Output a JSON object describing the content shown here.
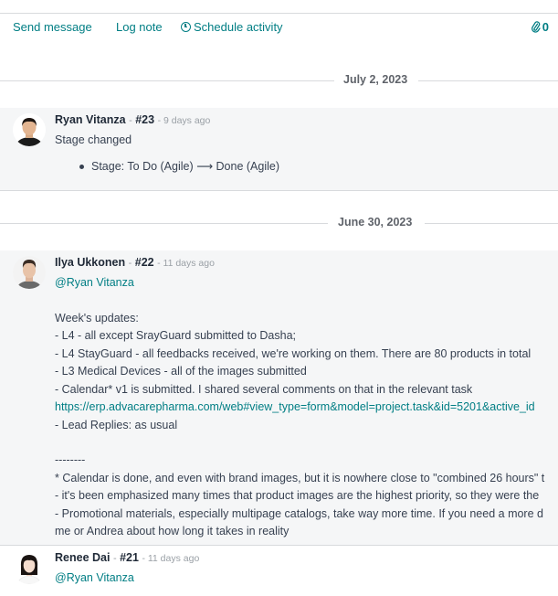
{
  "toolbar": {
    "send_message": "Send message",
    "log_note": "Log note",
    "schedule_activity": "Schedule activity",
    "attachments_count": "0"
  },
  "separators": [
    {
      "date": "July 2, 2023"
    },
    {
      "date": "June 30, 2023"
    }
  ],
  "messages": [
    {
      "author": "Ryan Vitanza",
      "dash": "-",
      "ref": "#23",
      "ago": "- 9 days ago",
      "body": "Stage changed",
      "tracking": {
        "field": "Stage:",
        "old": "To Do (Agile)",
        "arrow": "⟶",
        "new": "Done (Agile)"
      }
    },
    {
      "author": "Ilya Ukkonen",
      "dash": "-",
      "ref": "#22",
      "ago": "- 11 days ago",
      "mention": "@Ryan Vitanza",
      "lines": [
        "Week's updates:",
        "- L4 - all except SrayGuard submitted to Dasha;",
        "- L4 StayGuard - all feedbacks received, we're working on them. There are 80 products in total",
        "- L3 Medical Devices - all of the images submitted",
        "- Calendar* v1 is submitted. I shared several comments on that in the relevant task",
        "https://erp.advacarepharma.com/web#view_type=form&model=project.task&id=5201&active_id",
        "- Lead Replies: as usual",
        "--------",
        "* Calendar is done, and even with brand images, but it is nowhere close to \"combined 26 hours\" t",
        "- it's been emphasized many times that product images are the highest priority, so they were the",
        "- Promotional materials, especially multipage catalogs, take way more time. If you need a more d",
        "me or Andrea about how long it takes in reality"
      ]
    },
    {
      "author": "Renee Dai",
      "dash": "-",
      "ref": "#21",
      "ago": "- 11 days ago",
      "mention": "@Ryan Vitanza"
    }
  ]
}
